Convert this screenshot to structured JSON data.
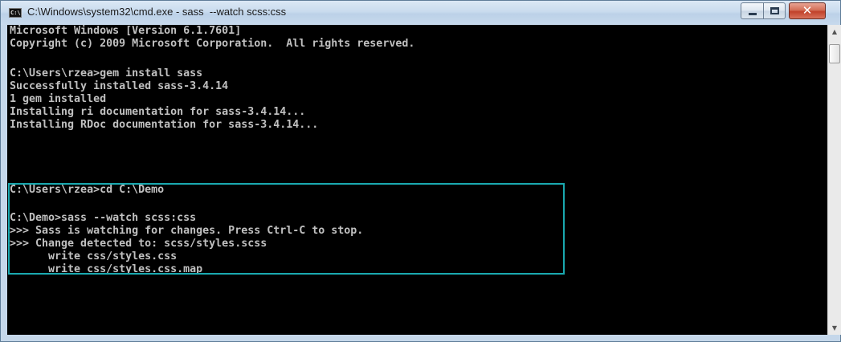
{
  "window": {
    "title": "C:\\Windows\\system32\\cmd.exe - sass  --watch scss:css",
    "icon_label": "C:\\."
  },
  "captions": {
    "minimize": "minimize",
    "maximize": "maximize",
    "close": "✕"
  },
  "console": {
    "lines": [
      "Microsoft Windows [Version 6.1.7601]",
      "Copyright (c) 2009 Microsoft Corporation.  All rights reserved.",
      "",
      "C:\\Users\\rzea>gem install sass",
      "Successfully installed sass-3.4.14",
      "1 gem installed",
      "Installing ri documentation for sass-3.4.14...",
      "Installing RDoc documentation for sass-3.4.14...",
      "",
      "C:\\Users\\rzea>cd C:\\Demo",
      "",
      "C:\\Demo>sass --watch scss:css",
      ">>> Sass is watching for changes. Press Ctrl-C to stop.",
      ">>> Change detected to: scss/styles.scss",
      "      write css/styles.css",
      "      write css/styles.css.map"
    ]
  },
  "scrollbar": {
    "up_arrow": "▲",
    "down_arrow": "▼"
  },
  "colors": {
    "highlight_border": "#1aa9b0",
    "console_bg": "#000000",
    "console_text": "#c0c0c0"
  }
}
